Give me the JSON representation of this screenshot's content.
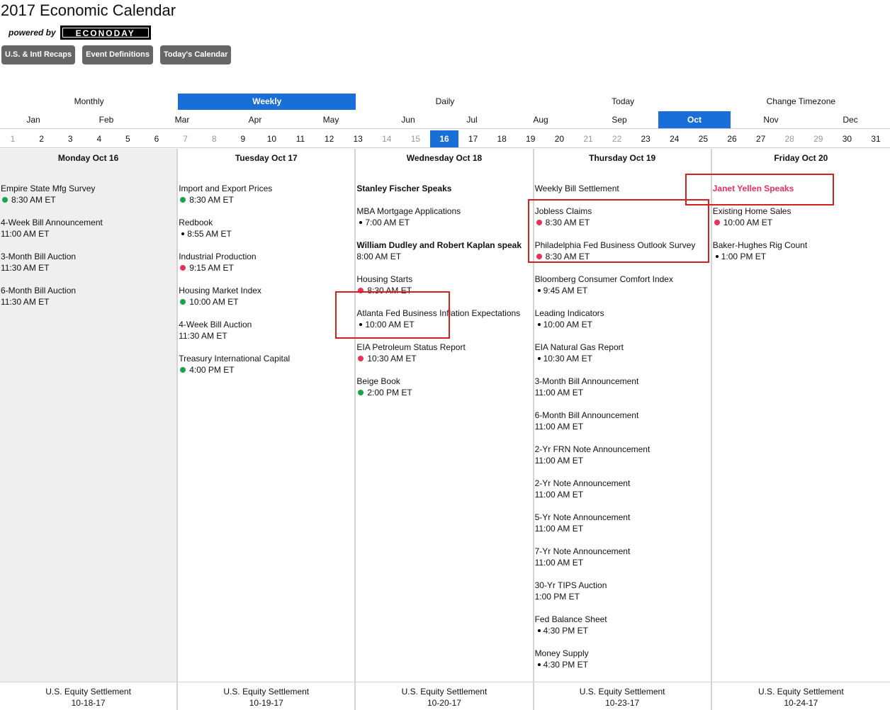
{
  "header": {
    "title": "2017 Economic Calendar",
    "powered_by": "powered by",
    "logo_text": "ECONODAY"
  },
  "nav_buttons": [
    "U.S. & Intl Recaps",
    "Event Definitions",
    "Today's Calendar"
  ],
  "views": [
    {
      "label": "Monthly",
      "active": false
    },
    {
      "label": "Weekly",
      "active": true
    },
    {
      "label": "Daily",
      "active": false
    },
    {
      "label": "Today",
      "active": false
    },
    {
      "label": "Change Timezone",
      "active": false
    }
  ],
  "months": [
    {
      "label": "Jan",
      "active": false
    },
    {
      "label": "Feb",
      "active": false
    },
    {
      "label": "Mar",
      "active": false
    },
    {
      "label": "Apr",
      "active": false
    },
    {
      "label": "May",
      "active": false
    },
    {
      "label": "Jun",
      "active": false
    },
    {
      "label": "Jul",
      "active": false
    },
    {
      "label": "Aug",
      "active": false
    },
    {
      "label": "Sep",
      "active": false
    },
    {
      "label": "Oct",
      "active": true
    },
    {
      "label": "Nov",
      "active": false
    },
    {
      "label": "Dec",
      "active": false
    }
  ],
  "days": {
    "numbers": [
      "1",
      "2",
      "3",
      "4",
      "5",
      "6",
      "7",
      "8",
      "9",
      "10",
      "11",
      "12",
      "13",
      "14",
      "15",
      "16",
      "17",
      "18",
      "19",
      "20",
      "21",
      "22",
      "23",
      "24",
      "25",
      "26",
      "27",
      "28",
      "29",
      "30",
      "31"
    ],
    "weekend": [
      "1",
      "7",
      "8",
      "14",
      "15",
      "21",
      "22",
      "28",
      "29"
    ],
    "active": "16"
  },
  "columns": [
    {
      "header": "Monday Oct 16",
      "today": true,
      "events": [
        {
          "name": "Empire State Mfg Survey",
          "time": "8:30 AM ET",
          "dot": "green"
        },
        {
          "name": "4-Week Bill Announcement",
          "time": "11:00 AM ET",
          "dot": ""
        },
        {
          "name": "3-Month Bill Auction",
          "time": "11:30 AM ET",
          "dot": ""
        },
        {
          "name": "6-Month Bill Auction",
          "time": "11:30 AM ET",
          "dot": ""
        }
      ],
      "footer_label": "U.S. Equity Settlement",
      "footer_date": "10-18-17"
    },
    {
      "header": "Tuesday Oct 17",
      "today": false,
      "events": [
        {
          "name": "Import and Export Prices",
          "time": "8:30 AM ET",
          "dot": "green"
        },
        {
          "name": "Redbook",
          "time": "8:55 AM ET",
          "dot": "black"
        },
        {
          "name": "Industrial Production",
          "time": "9:15 AM ET",
          "dot": "red"
        },
        {
          "name": "Housing Market Index",
          "time": "10:00 AM ET",
          "dot": "green"
        },
        {
          "name": "4-Week Bill Auction",
          "time": "11:30 AM ET",
          "dot": ""
        },
        {
          "name": "Treasury International Capital",
          "time": "4:00 PM ET",
          "dot": "green"
        }
      ],
      "footer_label": "U.S. Equity Settlement",
      "footer_date": "10-19-17"
    },
    {
      "header": "Wednesday Oct 18",
      "today": false,
      "events": [
        {
          "name": "Stanley Fischer Speaks",
          "time": "",
          "dot": "",
          "style": "bold"
        },
        {
          "name": "MBA Mortgage Applications",
          "time": "7:00 AM ET",
          "dot": "black"
        },
        {
          "name": "William Dudley and Robert Kaplan speak",
          "time": "8:00 AM ET",
          "dot": "",
          "style": "bold"
        },
        {
          "name": "Housing Starts",
          "time": "8:30 AM ET",
          "dot": "red"
        },
        {
          "name": "Atlanta Fed Business Inflation Expectations",
          "time": "10:00 AM ET",
          "dot": "black"
        },
        {
          "name": "EIA Petroleum Status Report",
          "time": "10:30 AM ET",
          "dot": "red"
        },
        {
          "name": "Beige Book",
          "time": "2:00 PM ET",
          "dot": "green"
        }
      ],
      "footer_label": "U.S. Equity Settlement",
      "footer_date": "10-20-17"
    },
    {
      "header": "Thursday Oct 19",
      "today": false,
      "events": [
        {
          "name": "Weekly Bill Settlement",
          "time": "",
          "dot": ""
        },
        {
          "name": "Jobless Claims",
          "time": "8:30 AM ET",
          "dot": "red"
        },
        {
          "name": "Philadelphia Fed Business Outlook Survey",
          "time": "8:30 AM ET",
          "dot": "red"
        },
        {
          "name": "Bloomberg Consumer Comfort Index",
          "time": "9:45 AM ET",
          "dot": "black"
        },
        {
          "name": "Leading Indicators",
          "time": "10:00 AM ET",
          "dot": "black"
        },
        {
          "name": "EIA Natural Gas Report",
          "time": "10:30 AM ET",
          "dot": "black"
        },
        {
          "name": "3-Month Bill Announcement",
          "time": "11:00 AM ET",
          "dot": ""
        },
        {
          "name": "6-Month Bill Announcement",
          "time": "11:00 AM ET",
          "dot": ""
        },
        {
          "name": "2-Yr FRN Note Announcement",
          "time": "11:00 AM ET",
          "dot": ""
        },
        {
          "name": "2-Yr Note Announcement",
          "time": "11:00 AM ET",
          "dot": ""
        },
        {
          "name": "5-Yr Note Announcement",
          "time": "11:00 AM ET",
          "dot": ""
        },
        {
          "name": "7-Yr Note Announcement",
          "time": "11:00 AM ET",
          "dot": ""
        },
        {
          "name": "30-Yr TIPS Auction",
          "time": "1:00 PM ET",
          "dot": ""
        },
        {
          "name": "Fed Balance Sheet",
          "time": "4:30 PM ET",
          "dot": "black"
        },
        {
          "name": "Money Supply",
          "time": "4:30 PM ET",
          "dot": "black"
        }
      ],
      "footer_label": "U.S. Equity Settlement",
      "footer_date": "10-23-17"
    },
    {
      "header": "Friday Oct 20",
      "today": false,
      "events": [
        {
          "name": "Janet Yellen Speaks",
          "time": "",
          "dot": "",
          "style": "red"
        },
        {
          "name": "Existing Home Sales",
          "time": "10:00 AM ET",
          "dot": "red"
        },
        {
          "name": "Baker-Hughes Rig Count",
          "time": "1:00 PM ET",
          "dot": "black"
        }
      ],
      "footer_label": "U.S. Equity Settlement",
      "footer_date": "10-24-17"
    }
  ]
}
